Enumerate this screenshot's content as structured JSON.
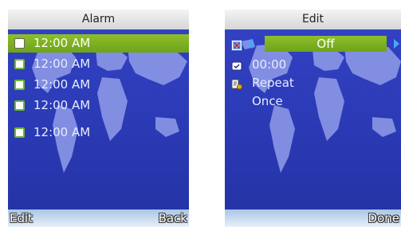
{
  "alarm_screen": {
    "title": "Alarm",
    "alarms": [
      {
        "time": "12:00 AM",
        "selected": true
      },
      {
        "time": "12:00 AM",
        "selected": false
      },
      {
        "time": "12:00 AM",
        "selected": false
      },
      {
        "time": "12:00 AM",
        "selected": false
      },
      {
        "time": "12:00 AM",
        "selected": false
      }
    ],
    "softkey_left": "Edit",
    "softkey_right": "Back"
  },
  "edit_screen": {
    "title": "Edit",
    "state_value": "Off",
    "time_value": "00:00",
    "repeat_label": "Repeat",
    "repeat_value": "Once",
    "softkey_right": "Done"
  },
  "colors": {
    "background_blue": "#2b3aa8",
    "highlight_green": "#7bb01f",
    "arrow_blue": "#45a8ff"
  }
}
